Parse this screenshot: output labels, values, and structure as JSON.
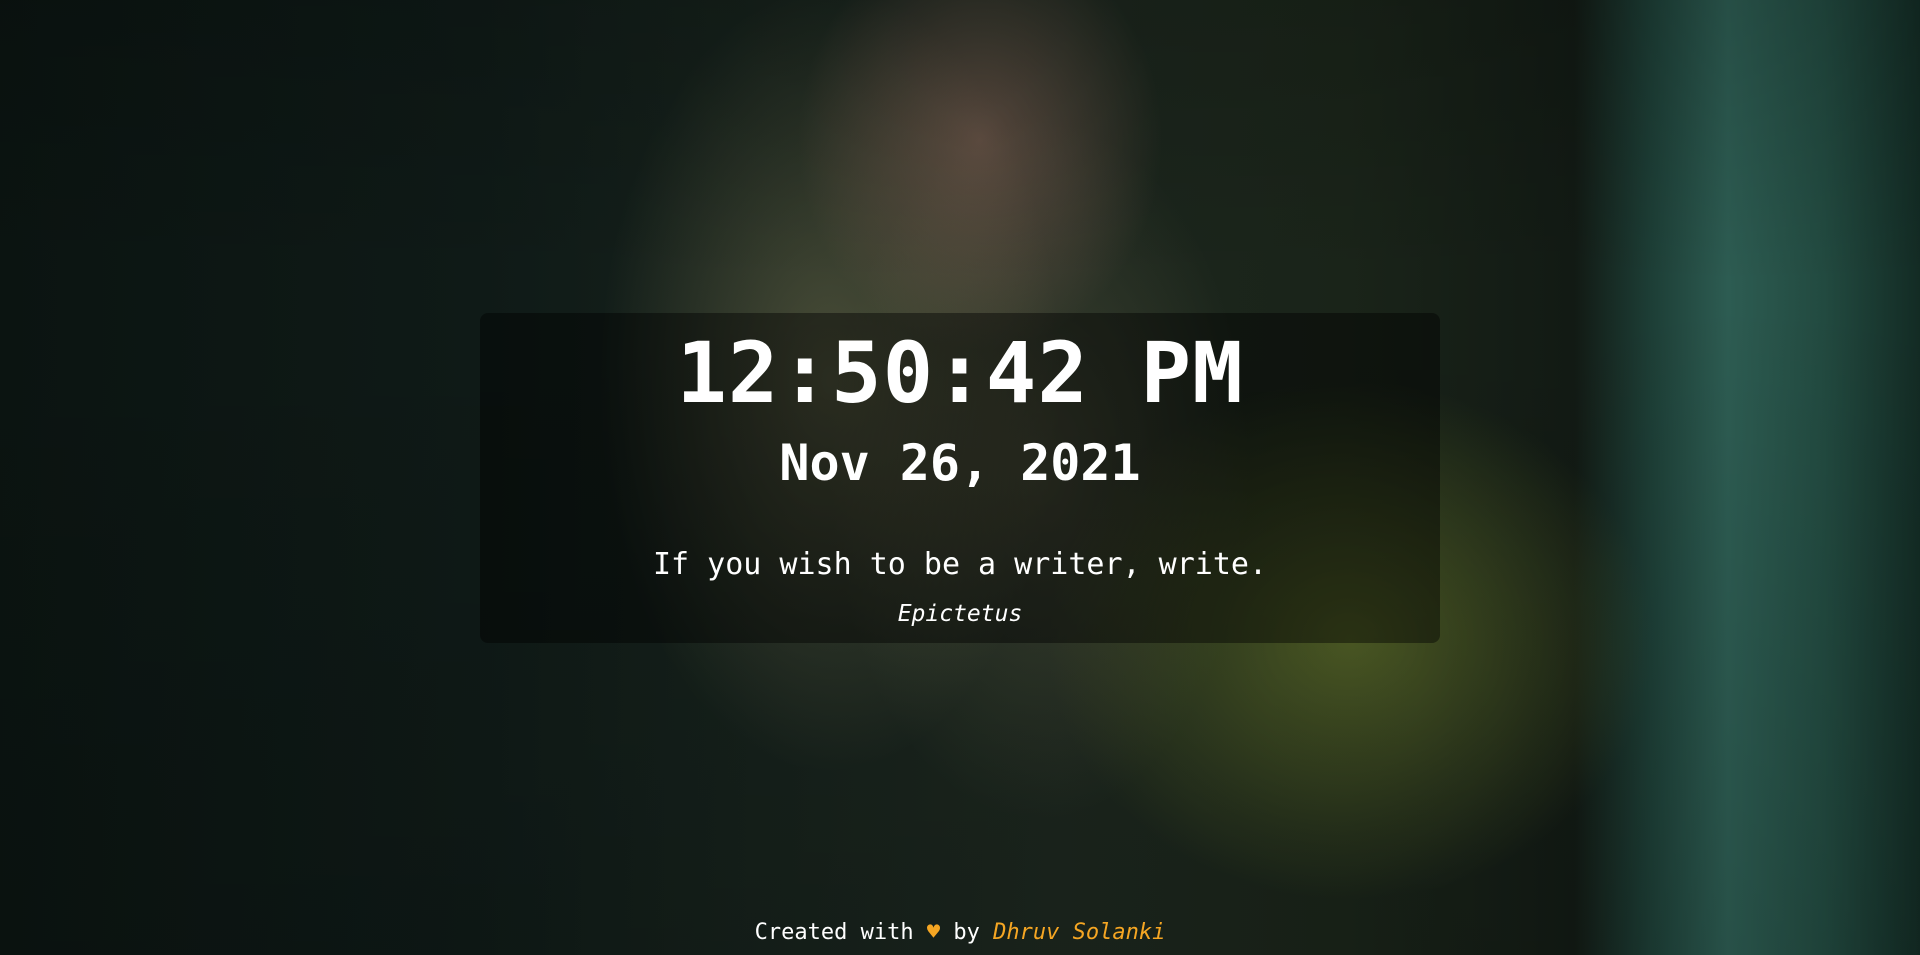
{
  "clock": {
    "time": "12:50:42 PM",
    "date": "Nov 26, 2021"
  },
  "quote": {
    "text": "If you wish to be a writer, write.",
    "author": "Epictetus"
  },
  "footer": {
    "prefix": "Created with",
    "heart": "♥",
    "by": "by",
    "creator": "Dhruv Solanki"
  },
  "colors": {
    "accent": "#f5a623",
    "text": "#ffffff",
    "card_bg": "rgba(0,0,0,0.42)"
  },
  "background": {
    "icon": "background-photo"
  }
}
